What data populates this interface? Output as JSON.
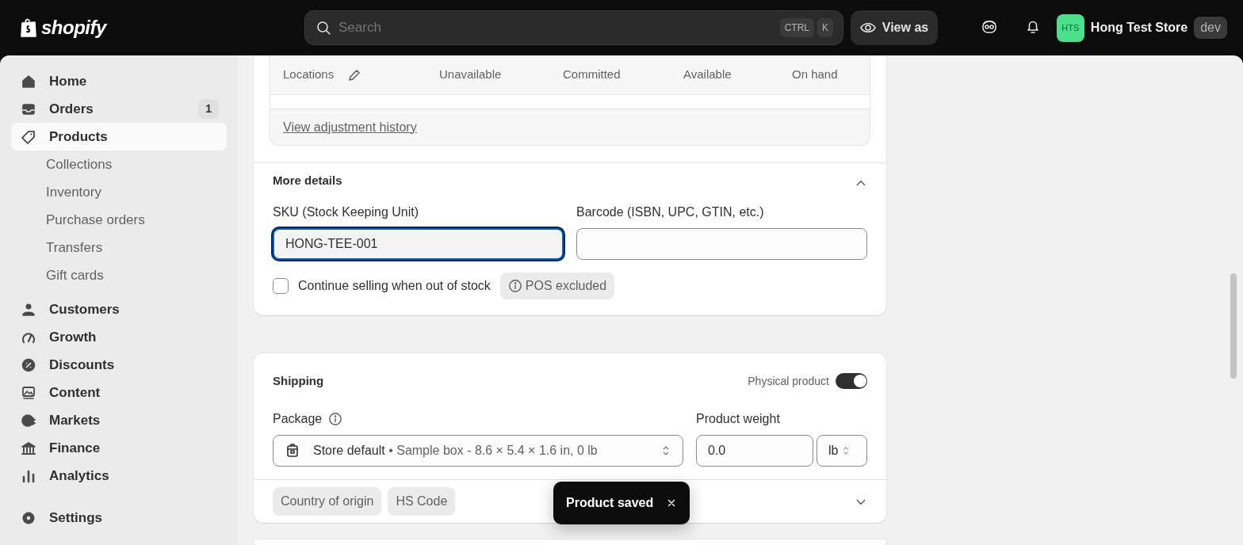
{
  "topbar": {
    "logo_text": "shopify",
    "search": {
      "placeholder": "Search",
      "keys": [
        "CTRL",
        "K"
      ]
    },
    "view_as": "View as",
    "store": {
      "initials": "HTS",
      "name": "Hong Test Store",
      "badge": "dev"
    }
  },
  "sidebar": {
    "sections": [
      {
        "items": [
          {
            "label": "Home",
            "selected": false
          },
          {
            "label": "Orders",
            "selected": false,
            "badge": "1"
          },
          {
            "label": "Products",
            "selected": true,
            "children": [
              {
                "label": "Collections",
                "selected": false
              },
              {
                "label": "Inventory",
                "selected": false
              },
              {
                "label": "Purchase orders",
                "selected": false
              },
              {
                "label": "Transfers",
                "selected": false
              },
              {
                "label": "Gift cards",
                "selected": false
              }
            ]
          },
          {
            "label": "Customers",
            "selected": false
          },
          {
            "label": "Growth",
            "selected": false
          },
          {
            "label": "Discounts",
            "selected": false
          },
          {
            "label": "Content",
            "selected": false
          },
          {
            "label": "Markets",
            "selected": false
          },
          {
            "label": "Finance",
            "selected": false
          },
          {
            "label": "Analytics",
            "selected": false
          }
        ]
      },
      {
        "items": [
          {
            "label": "Settings",
            "selected": false
          }
        ]
      }
    ]
  },
  "inventory": {
    "columns": [
      "Locations",
      "Unavailable",
      "Committed",
      "Available",
      "On hand"
    ],
    "history_link": "View adjustment history"
  },
  "more_details": {
    "title": "More details",
    "expanded": true,
    "sku": {
      "label": "SKU (Stock Keeping Unit)",
      "value": "HONG-TEE-001",
      "focused": true
    },
    "barcode": {
      "label": "Barcode (ISBN, UPC, GTIN, etc.)"
    },
    "continue_selling": {
      "label": "Continue selling when out of stock",
      "checked": false
    },
    "pos_badge": "POS excluded"
  },
  "shipping": {
    "title": "Shipping",
    "physical_product": {
      "label": "Physical product",
      "on": true
    },
    "package": {
      "label": "Package",
      "name": "Store default",
      "detail": "• Sample box - 8.6 × 5.4 × 1.6 in, 0 lb"
    },
    "weight": {
      "label": "Product weight",
      "value": "0.0",
      "unit": "lb"
    },
    "chips": [
      "Country of origin",
      "HS Code"
    ],
    "expanded": false
  },
  "toast": {
    "message": "Product saved"
  }
}
